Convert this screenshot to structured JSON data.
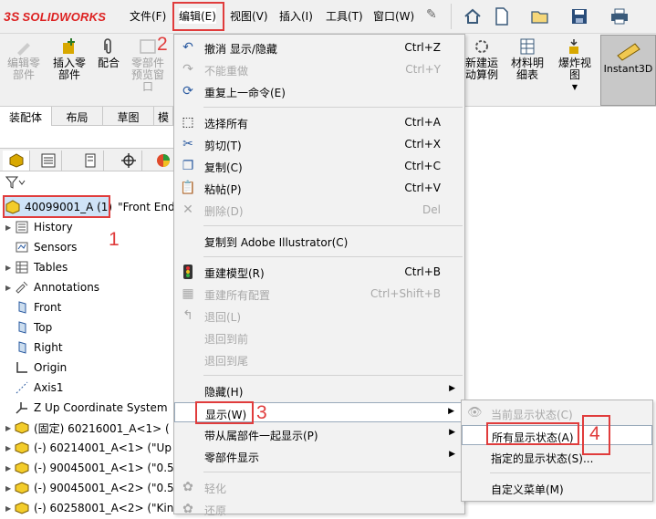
{
  "app": {
    "logo_text": "SOLIDWORKS",
    "logo_mark": "3S"
  },
  "menubar": {
    "items": [
      "文件(F)",
      "编辑(E)",
      "视图(V)",
      "插入(I)",
      "工具(T)",
      "窗口(W)"
    ],
    "pin_icon": "pin-icon"
  },
  "toolbar_icons": [
    "home-icon",
    "new-file-icon",
    "open-folder-icon",
    "save-icon",
    "print-icon"
  ],
  "ribbon": {
    "edit_component": "编辑零\n部件",
    "insert_component": "插入零\n部件",
    "mate": "配合",
    "component_preview": "零部件\n预览窗\n口",
    "new_motion_study": "新建运\n动算例",
    "bom": "材料明\n细表",
    "exploded_view": "爆炸视\n图",
    "instant3d": "Instant3D"
  },
  "tabs": [
    "装配体",
    "布局",
    "草图",
    "模"
  ],
  "tree": {
    "root": "40099001_A (1)",
    "root_config": "\"Front End",
    "items": [
      {
        "label": "History",
        "icon": "history-icon",
        "expand": true
      },
      {
        "label": "Sensors",
        "icon": "sensors-icon",
        "expand": false
      },
      {
        "label": "Tables",
        "icon": "tables-icon",
        "expand": true
      },
      {
        "label": "Annotations",
        "icon": "annotations-icon",
        "expand": true
      },
      {
        "label": "Front",
        "icon": "plane-icon",
        "expand": false
      },
      {
        "label": "Top",
        "icon": "plane-icon",
        "expand": false
      },
      {
        "label": "Right",
        "icon": "plane-icon",
        "expand": false
      },
      {
        "label": "Origin",
        "icon": "origin-icon",
        "expand": false
      },
      {
        "label": "Axis1",
        "icon": "axis-icon",
        "expand": false
      },
      {
        "label": "Z Up Coordinate System",
        "icon": "coordinate-system-icon",
        "expand": false
      },
      {
        "label": "(固定) 60216001_A<1> (",
        "icon": "part-icon",
        "expand": true
      },
      {
        "label": "(-) 60214001_A<1> (\"Up",
        "icon": "part-icon",
        "expand": true
      },
      {
        "label": "(-) 90045001_A<1> (\"0.5",
        "icon": "part-icon",
        "expand": true
      },
      {
        "label": "(-) 90045001_A<2> (\"0.5",
        "icon": "part-icon",
        "expand": true
      },
      {
        "label": "(-) 60258001_A<2> (\"Kin",
        "icon": "part-icon",
        "expand": true
      }
    ]
  },
  "edit_menu": {
    "undo": {
      "label": "撤消 显示/隐藏",
      "shortcut": "Ctrl+Z"
    },
    "redo_cannot": {
      "label": "不能重做",
      "shortcut": "Ctrl+Y"
    },
    "repeat_last": {
      "label": "重复上一命令(E)"
    },
    "select_all": {
      "label": "选择所有",
      "shortcut": "Ctrl+A"
    },
    "cut": {
      "label": "剪切(T)",
      "shortcut": "Ctrl+X"
    },
    "copy": {
      "label": "复制(C)",
      "shortcut": "Ctrl+C"
    },
    "paste": {
      "label": "粘帖(P)",
      "shortcut": "Ctrl+V"
    },
    "delete": {
      "label": "删除(D)",
      "shortcut": "Del"
    },
    "copy_ai": {
      "label": "复制到 Adobe Illustrator(C)"
    },
    "rebuild": {
      "label": "重建模型(R)",
      "shortcut": "Ctrl+B"
    },
    "rebuild_all": {
      "label": "重建所有配置",
      "shortcut": "Ctrl+Shift+B"
    },
    "rollback": {
      "label": "退回(L)"
    },
    "roll_forward": {
      "label": "退回到前"
    },
    "roll_to_end": {
      "label": "退回到尾"
    },
    "hide": {
      "label": "隐藏(H)"
    },
    "show": {
      "label": "显示(W)"
    },
    "show_with_dependents": {
      "label": "带从属部件一起显示(P)"
    },
    "component_display": {
      "label": "零部件显示"
    },
    "lightweight": {
      "label": "轻化"
    },
    "restore": {
      "label": "还原"
    }
  },
  "show_submenu": {
    "current_state": "当前显示状态(C)",
    "all_states": "所有显示状态(A)",
    "specified_states": "指定的显示状态(S)...",
    "customize": "自定义菜单(M)"
  },
  "annotations": {
    "n1": "1",
    "n2": "2",
    "n3": "3",
    "n4": "4"
  },
  "colors": {
    "highlight_red": "#e03c3c",
    "menu_bg": "#f2f2f2",
    "logo_red": "#d22222"
  }
}
